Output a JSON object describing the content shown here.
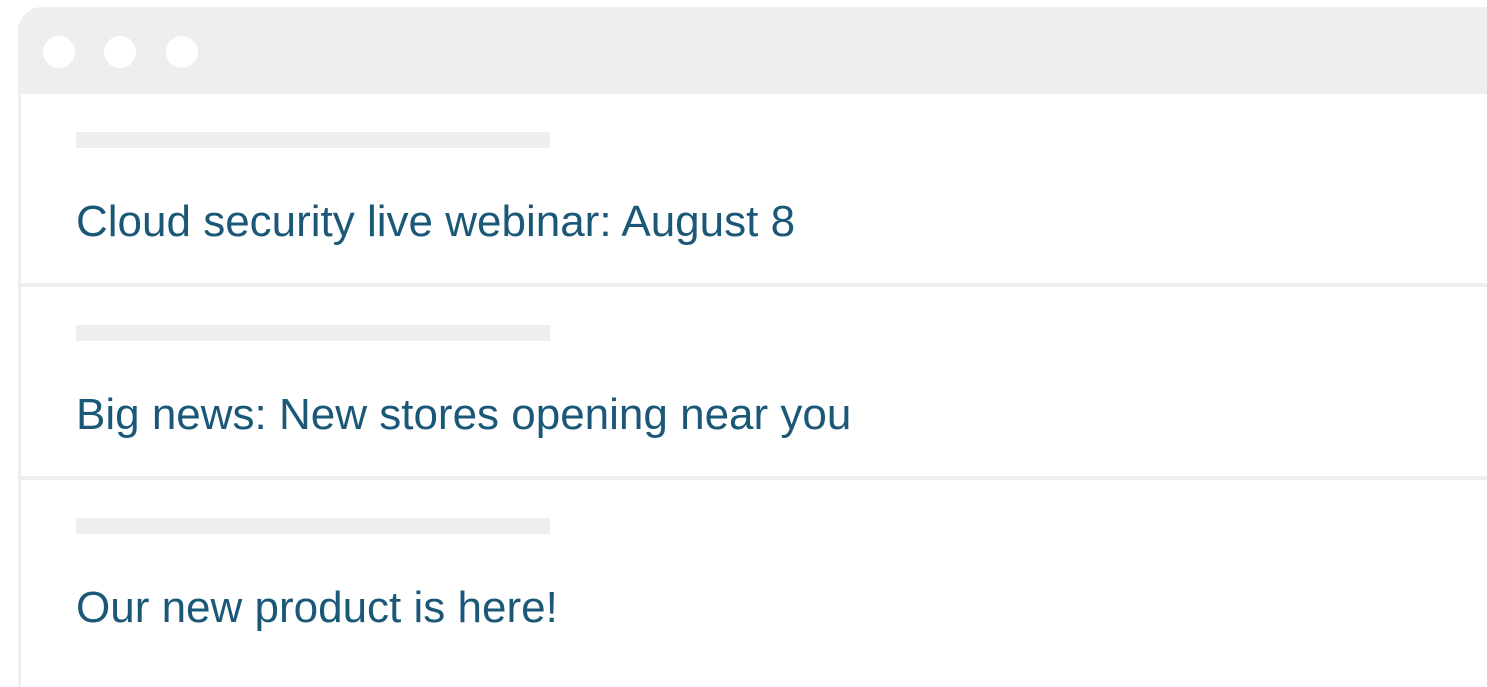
{
  "colors": {
    "chrome": "#eceeef",
    "link_text": "#1b5878",
    "background": "#ffffff"
  },
  "window": {
    "controls": [
      "window-dot-icon",
      "window-dot-icon",
      "window-dot-icon"
    ]
  },
  "list": {
    "items": [
      {
        "title": "Cloud security live webinar: August 8"
      },
      {
        "title": "Big news: New stores opening near you"
      },
      {
        "title": "Our new product is here!"
      }
    ]
  }
}
